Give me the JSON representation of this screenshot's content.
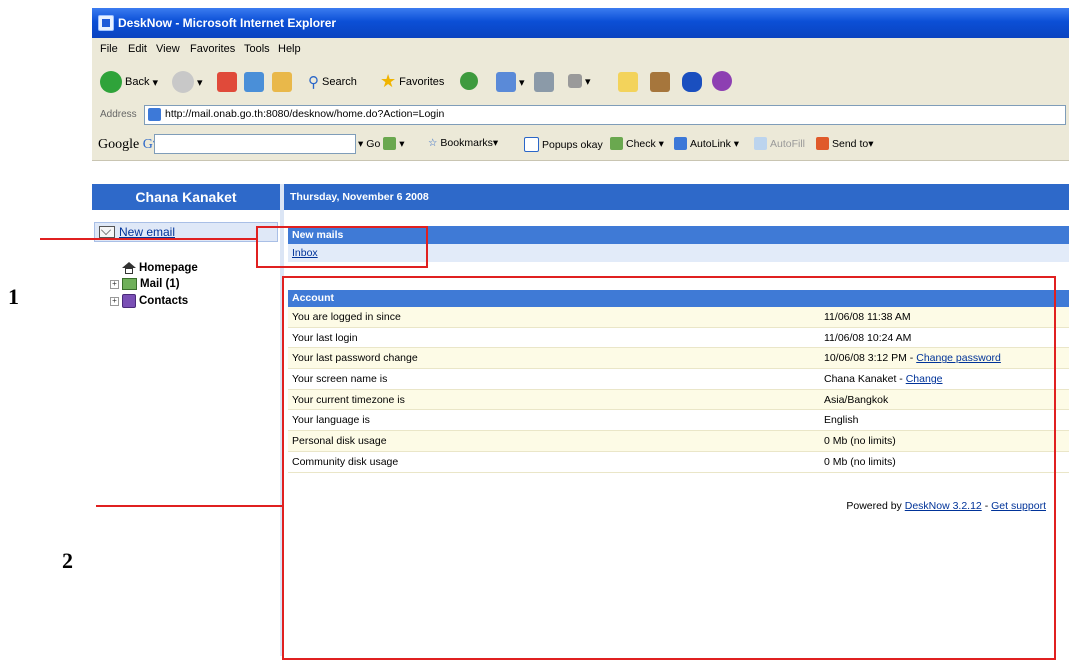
{
  "window": {
    "title": "DeskNow - Microsoft Internet Explorer"
  },
  "menu": [
    "File",
    "Edit",
    "View",
    "Favorites",
    "Tools",
    "Help"
  ],
  "toolbar": {
    "back_label": "Back",
    "search_label": "Search",
    "favorites_label": "Favorites"
  },
  "address": {
    "label": "Address",
    "url": "http://mail.onab.go.th:8080/desknow/home.do?Action=Login"
  },
  "googlebar": {
    "logo": "Google",
    "logo_suffix": "G▾",
    "go_label": "Go",
    "bookmarks_label": "Bookmarks▾",
    "popups_label": "Popups okay",
    "check_label": "Check ▾",
    "autolink_label": "AutoLink ▾",
    "autofill_label": "AutoFill",
    "sendto_label": "Send to▾"
  },
  "app": {
    "user_name": "Chana Kanaket",
    "date": "Thursday, November 6 2008",
    "new_email_label": "New email",
    "tree": [
      {
        "label": "Homepage"
      },
      {
        "label": "Mail (1)"
      },
      {
        "label": "Contacts"
      }
    ],
    "new_mails_header": "New mails",
    "inbox_label": "Inbox",
    "account": {
      "header": "Account",
      "rows": [
        {
          "key": "You are logged in since",
          "value": "11/06/08 11:38 AM",
          "link": ""
        },
        {
          "key": "Your last login",
          "value": "11/06/08 10:24 AM",
          "link": ""
        },
        {
          "key": "Your last password change",
          "value": "10/06/08 3:12 PM - ",
          "link": "Change password"
        },
        {
          "key": "Your screen name is",
          "value": "Chana Kanaket - ",
          "link": "Change"
        },
        {
          "key": "Your current timezone is",
          "value": "Asia/Bangkok",
          "link": ""
        },
        {
          "key": "Your language is",
          "value": "English",
          "link": ""
        },
        {
          "key": "Personal disk usage",
          "value": "0 Mb (no limits)",
          "link": ""
        },
        {
          "key": "Community disk usage",
          "value": "0 Mb (no limits)",
          "link": ""
        }
      ]
    },
    "footer": {
      "prefix": "Powered by ",
      "product_link": "DeskNow 3.2.12",
      "separator": " - ",
      "support_link": "Get support"
    }
  },
  "annotations": {
    "marker_1": "1",
    "marker_2": "2",
    "color": "#e02020"
  }
}
